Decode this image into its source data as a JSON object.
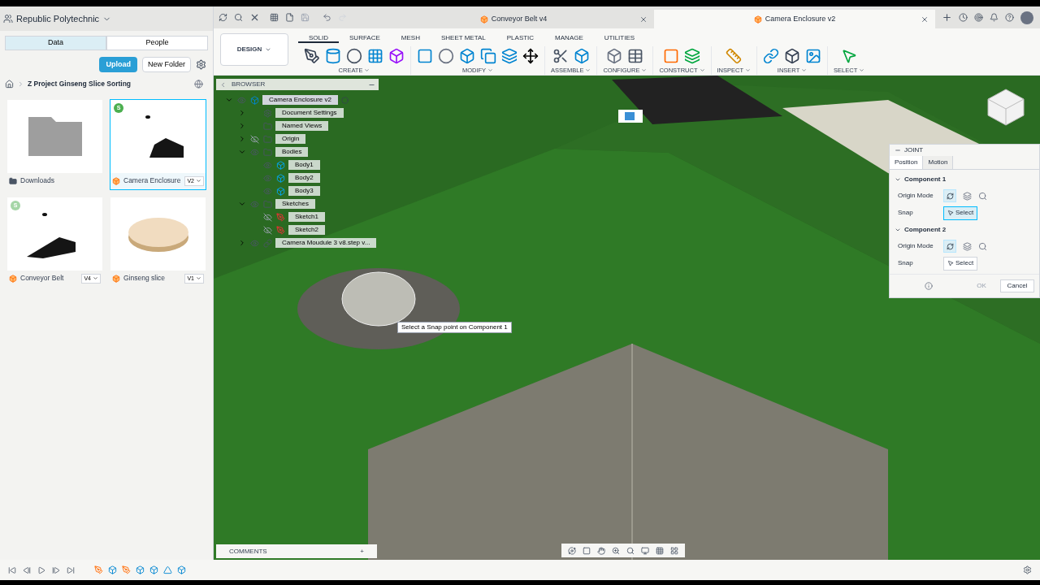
{
  "team": {
    "name": "Republic Polytechnic"
  },
  "data_panel": {
    "tabs": [
      {
        "label": "Data",
        "selected": true
      },
      {
        "label": "People",
        "selected": false
      }
    ],
    "upload": "Upload",
    "new_folder": "New Folder",
    "breadcrumb": "Z Project Ginseng Slice Sorting",
    "files": [
      {
        "kind": "folder",
        "name": "Downloads",
        "selected": false
      },
      {
        "kind": "design",
        "name": "Camera Enclosure",
        "version": "V2",
        "selected": true,
        "badge": "S",
        "color": "#4caf50"
      },
      {
        "kind": "design",
        "name": "Conveyor Belt",
        "version": "V4",
        "selected": false,
        "badge": "S",
        "color": "#a5d6a7"
      },
      {
        "kind": "design",
        "name": "Ginseng slice",
        "version": "V1",
        "selected": false
      }
    ]
  },
  "doc_tabs": [
    {
      "title": "Conveyor Belt v4",
      "selected": false
    },
    {
      "title": "Camera Enclosure v2",
      "selected": true
    }
  ],
  "toolbar": {
    "workspace": "DESIGN",
    "tabs": [
      {
        "label": "SOLID",
        "selected": true
      },
      {
        "label": "SURFACE",
        "selected": false
      },
      {
        "label": "MESH",
        "selected": false
      },
      {
        "label": "SHEET METAL",
        "selected": false
      },
      {
        "label": "PLASTIC",
        "selected": false
      },
      {
        "label": "MANAGE",
        "selected": false
      },
      {
        "label": "UTILITIES",
        "selected": false
      }
    ],
    "groups": [
      {
        "label": "CREATE",
        "tools": [
          {
            "kind": "sketch"
          },
          {
            "kind": "extrude"
          },
          {
            "kind": "hole"
          },
          {
            "kind": "pattern"
          },
          {
            "kind": "form"
          }
        ]
      },
      {
        "label": "MODIFY",
        "tools": [
          {
            "kind": "press"
          },
          {
            "kind": "fillet"
          },
          {
            "kind": "shell"
          },
          {
            "kind": "combine"
          },
          {
            "kind": "stack"
          },
          {
            "kind": "move"
          }
        ]
      },
      {
        "label": "ASSEMBLE",
        "tools": [
          {
            "kind": "joint"
          },
          {
            "kind": "component"
          }
        ]
      },
      {
        "label": "CONFIGURE",
        "tools": [
          {
            "kind": "box"
          },
          {
            "kind": "table"
          }
        ]
      },
      {
        "label": "CONSTRUCT",
        "tools": [
          {
            "kind": "plane"
          },
          {
            "kind": "midplane"
          }
        ]
      },
      {
        "label": "INSPECT",
        "tools": [
          {
            "kind": "measure"
          }
        ]
      },
      {
        "label": "INSERT",
        "tools": [
          {
            "kind": "link"
          },
          {
            "kind": "insert"
          },
          {
            "kind": "image"
          }
        ]
      },
      {
        "label": "SELECT",
        "tools": [
          {
            "kind": "select"
          }
        ]
      }
    ]
  },
  "browser": {
    "title": "BROWSER",
    "root": {
      "kind": "component",
      "label": "Camera Enclosure v2",
      "expanded": true,
      "visible": true,
      "selected": true,
      "children": [
        {
          "kind": "gear",
          "label": "Document Settings",
          "expanded": false,
          "selected": false
        },
        {
          "kind": "folder",
          "label": "Named Views",
          "expanded": false,
          "selected": false
        },
        {
          "kind": "folder",
          "label": "Origin",
          "expanded": false,
          "visible": false,
          "selected": false
        },
        {
          "kind": "folder",
          "label": "Bodies",
          "expanded": true,
          "visible": true,
          "selected": false,
          "children": [
            {
              "kind": "body",
              "label": "Body1",
              "visible": true,
              "selected": false
            },
            {
              "kind": "body",
              "label": "Body2",
              "visible": true,
              "selected": false
            },
            {
              "kind": "body",
              "label": "Body3",
              "visible": true,
              "selected": false
            }
          ]
        },
        {
          "kind": "folder",
          "label": "Sketches",
          "expanded": true,
          "visible": true,
          "selected": false,
          "children": [
            {
              "kind": "sketch",
              "label": "Sketch1",
              "visible": false,
              "selected": false
            },
            {
              "kind": "sketch",
              "label": "Sketch2",
              "visible": false,
              "selected": false
            }
          ]
        },
        {
          "kind": "link",
          "label": "Camera Moudule 3 v8.step v...",
          "expanded": false,
          "visible": true,
          "selected": false
        }
      ]
    }
  },
  "tooltip": "Select a Snap point on Component 1",
  "joint": {
    "title": "JOINT",
    "tabs": [
      {
        "label": "Position",
        "selected": true
      },
      {
        "label": "Motion",
        "selected": false
      }
    ],
    "sections": [
      {
        "title": "Component 1",
        "origin_label": "Origin Mode",
        "snap_label": "Snap",
        "snap_button": "Select",
        "selected": true
      },
      {
        "title": "Component 2",
        "origin_label": "Origin Mode",
        "snap_label": "Snap",
        "snap_button": "Select",
        "selected": false
      }
    ],
    "ok": {
      "label": "OK",
      "disabled": true
    },
    "cancel": "Cancel"
  },
  "comments": {
    "title": "COMMENTS",
    "add": "+"
  },
  "timeline": {
    "features": [
      {
        "kind": "sketch"
      },
      {
        "kind": "body"
      },
      {
        "kind": "sketch"
      },
      {
        "kind": "body"
      },
      {
        "kind": "body"
      },
      {
        "kind": "mirror"
      },
      {
        "kind": "body"
      }
    ]
  }
}
